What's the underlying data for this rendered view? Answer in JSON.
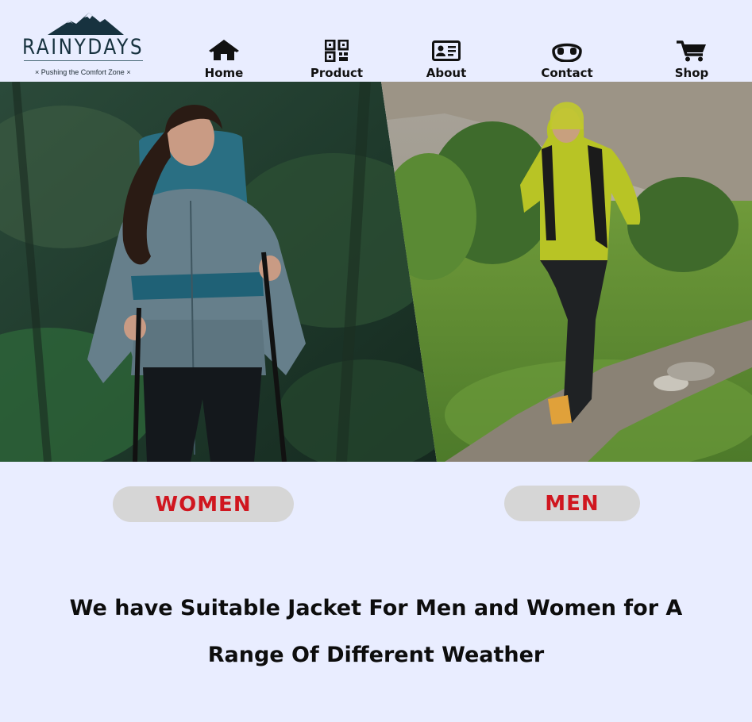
{
  "brand": {
    "name": "RAINYDAYS",
    "tagline": "× Pushing the Comfort Zone ×",
    "color": "#17323f"
  },
  "nav": {
    "items": [
      {
        "label": "Home",
        "icon": "home-icon"
      },
      {
        "label": "Product",
        "icon": "qr-code-icon"
      },
      {
        "label": "About",
        "icon": "id-card-icon"
      },
      {
        "label": "Contact",
        "icon": "headset-icon"
      },
      {
        "label": "Shop",
        "icon": "shopping-cart-icon"
      }
    ]
  },
  "hero": {
    "left_image": "woman-hiker-photo",
    "right_image": "man-hiker-photo"
  },
  "categories": {
    "women_label": "WOMEN",
    "men_label": "MEN",
    "label_color": "#d0161f",
    "button_color": "#d6d6d6"
  },
  "headline": {
    "line1": "We have Suitable Jacket For Men and Women for A",
    "line2": "Range Of Different Weather"
  },
  "colors": {
    "background": "#e9edff"
  }
}
